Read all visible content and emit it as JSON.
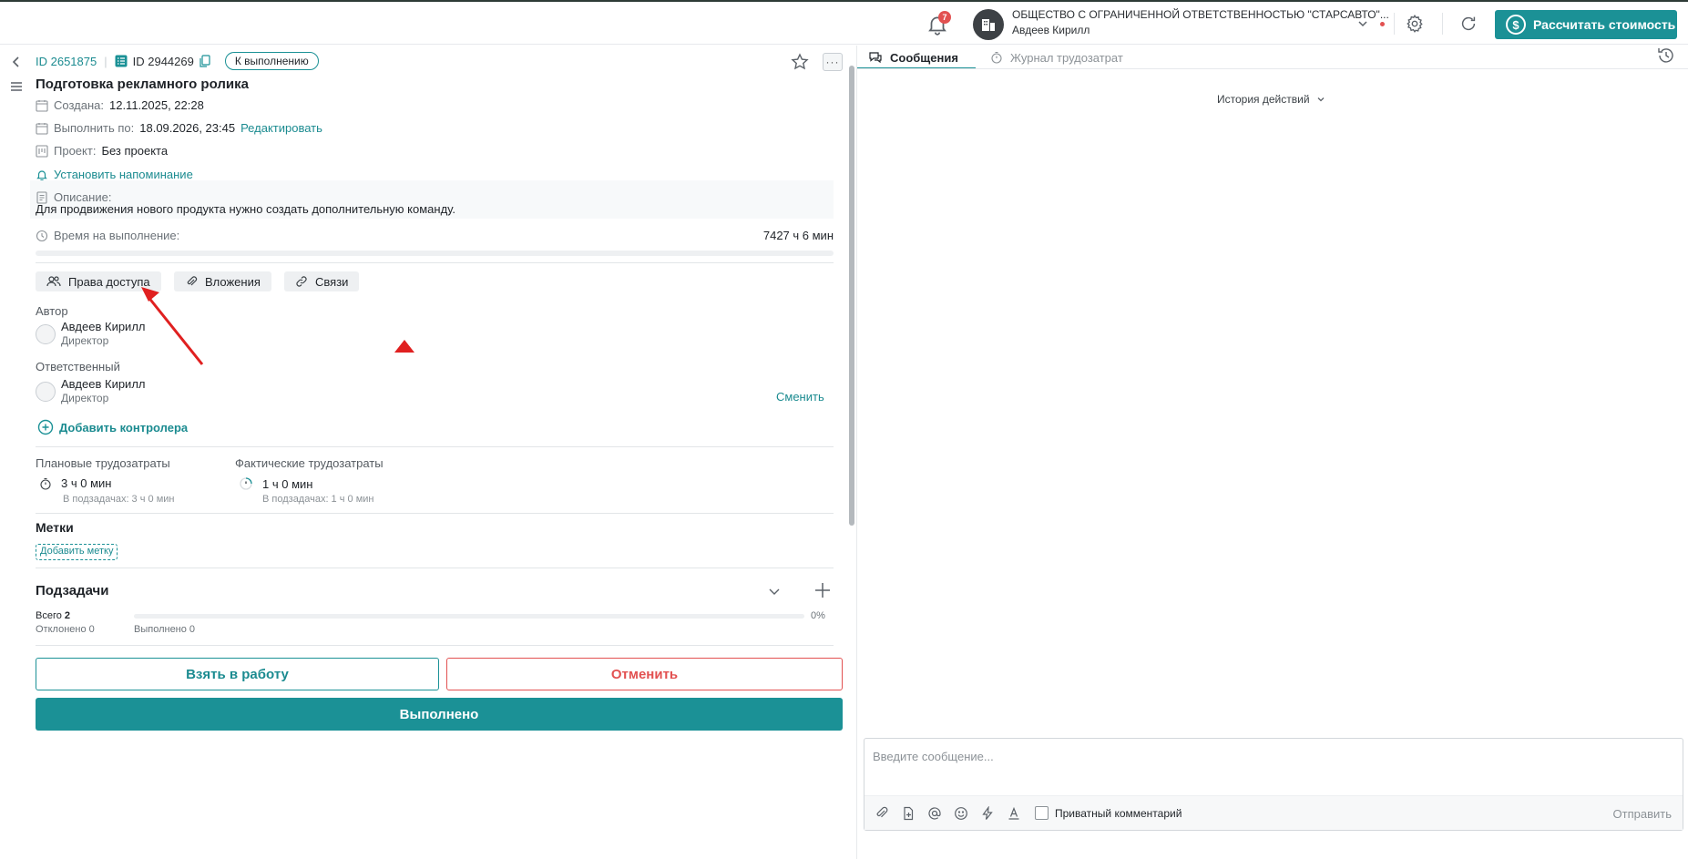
{
  "topbar": {
    "notifications_count": "7",
    "org_name": "ОБЩЕСТВО С ОГРАНИЧЕННОЙ ОТВЕТСТВЕННОСТЬЮ \"СТАРСАВТО\"...",
    "user_name": "Авдеев Кирилл",
    "calc_button_label": "Рассчитать стоимость",
    "accent_color": "#1b9196"
  },
  "task": {
    "id_link": "ID 2651875",
    "id_secondary": "ID 2944269",
    "status": "К выполнению",
    "title": "Подготовка рекламного ролика",
    "created_label": "Создана:",
    "created_value": "12.11.2025, 22:28",
    "due_label": "Выполнить по:",
    "due_value": "18.09.2026, 23:45",
    "edit_link": "Редактировать",
    "project_label": "Проект:",
    "project_value": "Без проекта",
    "reminder_link": "Установить напоминание",
    "description_label": "Описание:",
    "description_text": "Для продвижения нового продукта нужно создать дополнительную команду.",
    "time_label": "Время на выполнение:",
    "time_value": "7427 ч 6 мин"
  },
  "chips": {
    "access": "Права доступа",
    "attachments": "Вложения",
    "links": "Связи"
  },
  "people": {
    "author_label": "Автор",
    "author_name": "Авдеев Кирилл",
    "author_role": "Директор",
    "responsible_label": "Ответственный",
    "responsible_name": "Авдеев Кирилл",
    "responsible_role": "Директор",
    "change_link": "Сменить",
    "add_controller": "Добавить контролера"
  },
  "labor": {
    "planned_label": "Плановые трудозатраты",
    "planned_value": "3 ч 0 мин",
    "planned_sub": "В подзадачах: 3 ч 0 мин",
    "actual_label": "Фактические трудозатраты",
    "actual_value": "1 ч 0 мин",
    "actual_sub": "В подзадачах: 1 ч 0 мин"
  },
  "tags": {
    "title": "Метки",
    "add_tag": "Добавить метку"
  },
  "subtasks": {
    "title": "Подзадачи",
    "total_label": "Всего",
    "total_value": "2",
    "rejected": "Отклонено 0",
    "done": "Выполнено 0",
    "percent": "0%"
  },
  "actions": {
    "take": "Взять в работу",
    "cancel": "Отменить",
    "done": "Выполнено"
  },
  "right_panel": {
    "tab_messages": "Сообщения",
    "tab_journal": "Журнал трудозатрат",
    "history_label": "История действий",
    "message_placeholder": "Введите сообщение...",
    "private_comment": "Приватный комментарий",
    "send": "Отправить"
  }
}
